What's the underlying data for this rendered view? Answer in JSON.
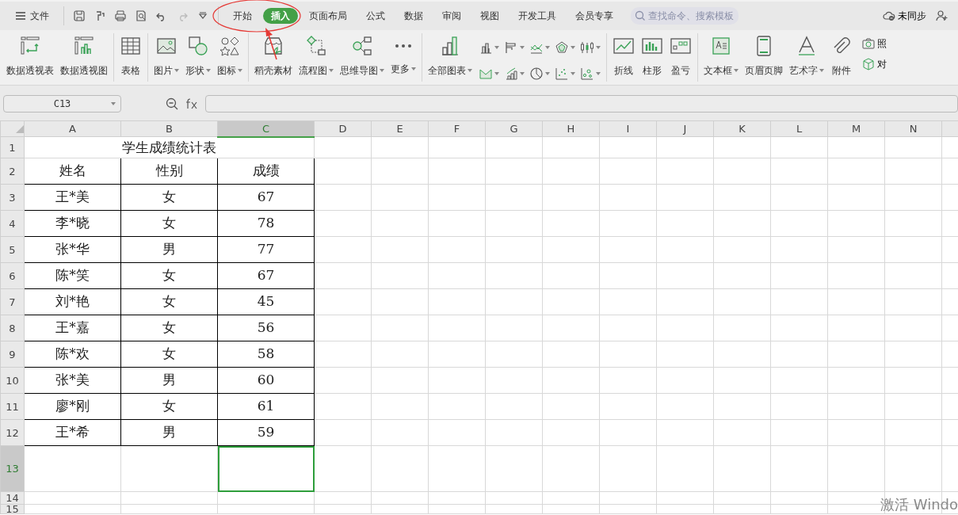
{
  "menu_bar": {
    "file_label": "文件",
    "tabs": [
      {
        "label": "开始",
        "selected": false
      },
      {
        "label": "插入",
        "selected": true
      },
      {
        "label": "页面布局",
        "selected": false
      },
      {
        "label": "公式",
        "selected": false
      },
      {
        "label": "数据",
        "selected": false
      },
      {
        "label": "审阅",
        "selected": false
      },
      {
        "label": "视图",
        "selected": false
      },
      {
        "label": "开发工具",
        "selected": false
      },
      {
        "label": "会员专享",
        "selected": false
      }
    ],
    "search": {
      "placeholder": "查找命令、搜索模板"
    },
    "sync_label": "未同步"
  },
  "ribbon": {
    "items": [
      {
        "kind": "large",
        "label": "数据透视表",
        "dropdown": false
      },
      {
        "kind": "large",
        "label": "数据透视图",
        "dropdown": false
      },
      {
        "kind": "separator"
      },
      {
        "kind": "large",
        "label": "表格",
        "dropdown": false
      },
      {
        "kind": "separator"
      },
      {
        "kind": "large",
        "label": "图片",
        "dropdown": true
      },
      {
        "kind": "large",
        "label": "形状",
        "dropdown": true
      },
      {
        "kind": "large",
        "label": "图标",
        "dropdown": true
      },
      {
        "kind": "separator"
      },
      {
        "kind": "large",
        "label": "稻壳素材",
        "dropdown": false
      },
      {
        "kind": "large",
        "label": "流程图",
        "dropdown": true
      },
      {
        "kind": "large",
        "label": "思维导图",
        "dropdown": true
      },
      {
        "kind": "large",
        "label": "更多",
        "dropdown": true
      },
      {
        "kind": "separator"
      },
      {
        "kind": "large",
        "label": "全部图表",
        "dropdown": true
      },
      {
        "kind": "chart_grid"
      },
      {
        "kind": "separator"
      },
      {
        "kind": "large",
        "label": "折线",
        "dropdown": false
      },
      {
        "kind": "large",
        "label": "柱形",
        "dropdown": false
      },
      {
        "kind": "large",
        "label": "盈亏",
        "dropdown": false
      },
      {
        "kind": "separator"
      },
      {
        "kind": "large",
        "label": "文本框",
        "dropdown": true
      },
      {
        "kind": "large",
        "label": "页眉页脚",
        "dropdown": false
      },
      {
        "kind": "large",
        "label": "艺术字",
        "dropdown": true
      },
      {
        "kind": "large",
        "label": "附件",
        "dropdown": false
      },
      {
        "kind": "small",
        "label": "照"
      },
      {
        "kind": "small",
        "label": "对"
      }
    ]
  },
  "formula_bar": {
    "name_box": "C13"
  },
  "sheet": {
    "columns": [
      {
        "label": "A",
        "selected": false
      },
      {
        "label": "B",
        "selected": false
      },
      {
        "label": "C",
        "selected": true
      },
      {
        "label": "D",
        "selected": false
      },
      {
        "label": "E",
        "selected": false
      },
      {
        "label": "F",
        "selected": false
      },
      {
        "label": "G",
        "selected": false
      },
      {
        "label": "H",
        "selected": false
      },
      {
        "label": "I",
        "selected": false
      },
      {
        "label": "J",
        "selected": false
      },
      {
        "label": "K",
        "selected": false
      },
      {
        "label": "L",
        "selected": false
      },
      {
        "label": "M",
        "selected": false
      },
      {
        "label": "N",
        "selected": false
      }
    ],
    "rows": [
      {
        "number": "1",
        "selected": false,
        "title": "学生成绩统计表"
      },
      {
        "number": "2",
        "selected": false,
        "bordered": true,
        "cells": [
          "姓名",
          "性别",
          "成绩"
        ]
      },
      {
        "number": "3",
        "selected": false,
        "bordered": true,
        "cells": [
          "王*美",
          "女",
          "67"
        ]
      },
      {
        "number": "4",
        "selected": false,
        "bordered": true,
        "cells": [
          "李*晓",
          "女",
          "78"
        ]
      },
      {
        "number": "5",
        "selected": false,
        "bordered": true,
        "cells": [
          "张*华",
          "男",
          "77"
        ]
      },
      {
        "number": "6",
        "selected": false,
        "bordered": true,
        "cells": [
          "陈*笑",
          "女",
          "67"
        ]
      },
      {
        "number": "7",
        "selected": false,
        "bordered": true,
        "cells": [
          "刘*艳",
          "女",
          "45"
        ]
      },
      {
        "number": "8",
        "selected": false,
        "bordered": true,
        "cells": [
          "王*嘉",
          "女",
          "56"
        ]
      },
      {
        "number": "9",
        "selected": false,
        "bordered": true,
        "cells": [
          "陈*欢",
          "女",
          "58"
        ]
      },
      {
        "number": "10",
        "selected": false,
        "bordered": true,
        "cells": [
          "张*美",
          "男",
          "60"
        ]
      },
      {
        "number": "11",
        "selected": false,
        "bordered": true,
        "cells": [
          "廖*刚",
          "女",
          "61"
        ]
      },
      {
        "number": "12",
        "selected": false,
        "bordered": true,
        "cells": [
          "王*希",
          "男",
          "59"
        ]
      },
      {
        "number": "13",
        "selected": true
      },
      {
        "number": "14",
        "selected": false
      },
      {
        "number": "15",
        "selected": false
      }
    ]
  },
  "os_watermark": "激活 Windo"
}
